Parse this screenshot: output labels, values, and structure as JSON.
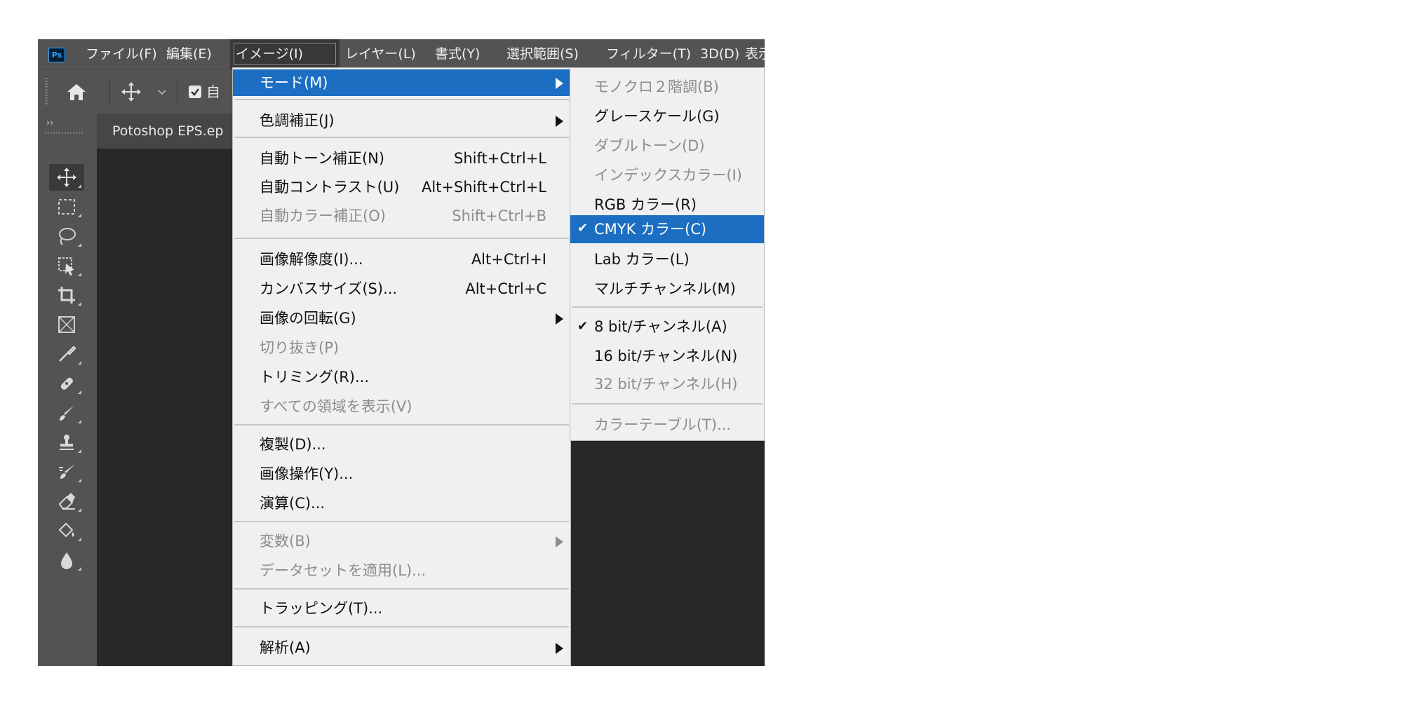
{
  "app": {
    "logo": "Ps"
  },
  "menubar": {
    "items": [
      "ファイル(F)",
      "編集(E)",
      "イメージ(I)",
      "レイヤー(L)",
      "書式(Y)",
      "選択範囲(S)",
      "フィルター(T)",
      "3D(D)",
      "表示"
    ],
    "active": "イメージ(I)"
  },
  "optionsbar": {
    "icons": [
      "home-icon",
      "move-icon",
      "chevron-down-icon",
      "checkbox-icon"
    ],
    "auto_label_partial": "自"
  },
  "toolbar": {
    "collapse": "››",
    "tools": [
      "move-tool-icon",
      "marquee-tool-icon",
      "lasso-tool-icon",
      "object-select-tool-icon",
      "crop-tool-icon",
      "frame-tool-icon",
      "eyedropper-tool-icon",
      "healing-brush-tool-icon",
      "brush-tool-icon",
      "clone-stamp-tool-icon",
      "history-brush-tool-icon",
      "eraser-tool-icon",
      "paint-bucket-tool-icon",
      "blur-tool-icon"
    ]
  },
  "document": {
    "tab_title": "Potoshop EPS.ep"
  },
  "image_menu": {
    "mode": "モード(M)",
    "adjustments": "色調補正(J)",
    "auto_tone": "自動トーン補正(N)",
    "auto_tone_sc": "Shift+Ctrl+L",
    "auto_contrast": "自動コントラスト(U)",
    "auto_contrast_sc": "Alt+Shift+Ctrl+L",
    "auto_color": "自動カラー補正(O)",
    "auto_color_sc": "Shift+Ctrl+B",
    "image_size": "画像解像度(I)...",
    "image_size_sc": "Alt+Ctrl+I",
    "canvas_size": "カンバスサイズ(S)...",
    "canvas_size_sc": "Alt+Ctrl+C",
    "rotation": "画像の回転(G)",
    "crop": "切り抜き(P)",
    "trim": "トリミング(R)...",
    "reveal_all": "すべての領域を表示(V)",
    "duplicate": "複製(D)...",
    "apply_image": "画像操作(Y)...",
    "calculations": "演算(C)...",
    "variables": "変数(B)",
    "apply_data_set": "データセットを適用(L)...",
    "trap": "トラッピング(T)...",
    "analysis": "解析(A)"
  },
  "mode_submenu": {
    "bitmap": "モノクロ２階調(B)",
    "grayscale": "グレースケール(G)",
    "duotone": "ダブルトーン(D)",
    "indexed": "インデックスカラー(I)",
    "rgb": "RGB カラー(R)",
    "cmyk": "CMYK カラー(C)",
    "lab": "Lab カラー(L)",
    "multichannel": "マルチチャンネル(M)",
    "bit8": "8 bit/チャンネル(A)",
    "bit16": "16 bit/チャンネル(N)",
    "bit32": "32 bit/チャンネル(H)",
    "color_table": "カラーテーブル(T)...",
    "check_mark": "✔"
  },
  "colors": {
    "highlight": "#1b6ec2",
    "menu_bg": "#f0f0f0",
    "chrome": "#535353",
    "canvas": "#282828"
  }
}
